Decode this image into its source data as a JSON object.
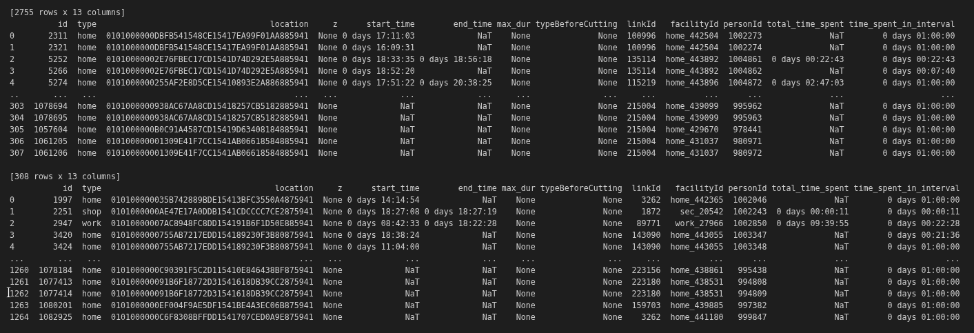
{
  "terminal": {
    "blocks": [
      {
        "kind": "text",
        "text": "[2755 rows x 13 columns]"
      },
      {
        "kind": "table",
        "columns": [
          {
            "header": "id",
            "kind": "number"
          },
          {
            "header": "type",
            "kind": "text"
          },
          {
            "header": "location",
            "kind": "text"
          },
          {
            "header": "z",
            "kind": "text"
          },
          {
            "header": "start_time",
            "kind": "duration"
          },
          {
            "header": "end_time",
            "kind": "duration"
          },
          {
            "header": "max_dur",
            "kind": "text"
          },
          {
            "header": "typeBeforeCutting",
            "kind": "text"
          },
          {
            "header": "linkId",
            "kind": "number"
          },
          {
            "header": "facilityId",
            "kind": "text"
          },
          {
            "header": "personId",
            "kind": "number"
          },
          {
            "header": "total_time_spent",
            "kind": "duration"
          },
          {
            "header": "time_spent_in_interval",
            "kind": "duration"
          }
        ],
        "rows": [
          {
            "index": "0",
            "cells": [
              "2311",
              "home",
              "0101000000DBFB541548CE15417EA99F01AA885941",
              "None",
              "0 days 17:11:03",
              "NaT",
              "None",
              "None",
              "100996",
              "home_442504",
              "1002273",
              "NaT",
              "0 days 01:00:00"
            ]
          },
          {
            "index": "1",
            "cells": [
              "2321",
              "home",
              "0101000000DBFB541548CE15417EA99F01AA885941",
              "None",
              "0 days 16:09:31",
              "NaT",
              "None",
              "None",
              "100996",
              "home_442504",
              "1002274",
              "NaT",
              "0 days 01:00:00"
            ]
          },
          {
            "index": "2",
            "cells": [
              "5252",
              "home",
              "01010000002E76FBEC17CD1541D74D292E5A885941",
              "None",
              "0 days 18:33:35",
              "0 days 18:56:18",
              "None",
              "None",
              "135114",
              "home_443892",
              "1004861",
              "0 days 00:22:43",
              "0 days 00:22:43"
            ]
          },
          {
            "index": "3",
            "cells": [
              "5266",
              "home",
              "01010000002E76FBEC17CD1541D74D292E5A885941",
              "None",
              "0 days 18:52:20",
              "NaT",
              "None",
              "None",
              "135114",
              "home_443892",
              "1004862",
              "NaT",
              "0 days 00:07:40"
            ]
          },
          {
            "index": "4",
            "cells": [
              "5274",
              "home",
              "0101000000255AF2E8D5CE15410893E2A886885941",
              "None",
              "0 days 17:51:22",
              "0 days 20:38:25",
              "None",
              "None",
              "115219",
              "home_443896",
              "1004872",
              "0 days 02:47:03",
              "0 days 01:00:00"
            ]
          },
          {
            "index": "..",
            "cells": [
              "...",
              "...",
              "...",
              "...",
              "...",
              "...",
              "...",
              "...",
              "...",
              "...",
              "...",
              "...",
              "..."
            ]
          },
          {
            "index": "303",
            "cells": [
              "1078694",
              "home",
              "0101000000938AC67AA8CD15418257CB5182885941",
              "None",
              "NaT",
              "NaT",
              "None",
              "None",
              "215004",
              "home_439099",
              "995962",
              "NaT",
              "0 days 01:00:00"
            ]
          },
          {
            "index": "304",
            "cells": [
              "1078695",
              "home",
              "0101000000938AC67AA8CD15418257CB5182885941",
              "None",
              "NaT",
              "NaT",
              "None",
              "None",
              "215004",
              "home_439099",
              "995963",
              "NaT",
              "0 days 01:00:00"
            ]
          },
          {
            "index": "305",
            "cells": [
              "1057604",
              "home",
              "0101000000B0C91A4587CD15419D63408184885941",
              "None",
              "NaT",
              "NaT",
              "None",
              "None",
              "215004",
              "home_429670",
              "978441",
              "NaT",
              "0 days 01:00:00"
            ]
          },
          {
            "index": "306",
            "cells": [
              "1061205",
              "home",
              "010100000001309E41F7CC1541AB06618584885941",
              "None",
              "NaT",
              "NaT",
              "None",
              "None",
              "215004",
              "home_431037",
              "980971",
              "NaT",
              "0 days 01:00:00"
            ]
          },
          {
            "index": "307",
            "cells": [
              "1061206",
              "home",
              "010100000001309E41F7CC1541AB06618584885941",
              "None",
              "NaT",
              "NaT",
              "None",
              "None",
              "215004",
              "home_431037",
              "980972",
              "NaT",
              "0 days 01:00:00"
            ]
          }
        ]
      },
      {
        "kind": "blank"
      },
      {
        "kind": "text",
        "text": "[308 rows x 13 columns]"
      },
      {
        "kind": "table",
        "columns": [
          {
            "header": "id",
            "kind": "number"
          },
          {
            "header": "type",
            "kind": "text"
          },
          {
            "header": "location",
            "kind": "text"
          },
          {
            "header": "z",
            "kind": "text"
          },
          {
            "header": "start_time",
            "kind": "duration"
          },
          {
            "header": "end_time",
            "kind": "duration"
          },
          {
            "header": "max_dur",
            "kind": "text"
          },
          {
            "header": "typeBeforeCutting",
            "kind": "text"
          },
          {
            "header": "linkId",
            "kind": "number"
          },
          {
            "header": "facilityId",
            "kind": "text"
          },
          {
            "header": "personId",
            "kind": "number"
          },
          {
            "header": "total_time_spent",
            "kind": "duration"
          },
          {
            "header": "time_spent_in_interval",
            "kind": "duration"
          }
        ],
        "rows": [
          {
            "index": "0",
            "cells": [
              "1997",
              "home",
              "010100000035B742889BDE15413BFC3550A4875941",
              "None",
              "0 days 14:14:54",
              "NaT",
              "None",
              "None",
              "3262",
              "home_442365",
              "1002046",
              "NaT",
              "0 days 01:00:00"
            ]
          },
          {
            "index": "1",
            "cells": [
              "2251",
              "shop",
              "0101000000AE47E17A0DDB1541CDCCCC7CE2875941",
              "None",
              "0 days 18:27:08",
              "0 days 18:27:19",
              "None",
              "None",
              "1872",
              "sec_20542",
              "1002243",
              "0 days 00:00:11",
              "0 days 00:00:11"
            ]
          },
          {
            "index": "2",
            "cells": [
              "2947",
              "work",
              "01010000007AC8948FC8DD154191B6F1D50E885941",
              "None",
              "0 days 08:42:33",
              "0 days 18:22:28",
              "None",
              "None",
              "89771",
              "work_27966",
              "1002850",
              "0 days 09:39:55",
              "0 days 00:22:28"
            ]
          },
          {
            "index": "3",
            "cells": [
              "3420",
              "home",
              "0101000000755AB7217EDD154189230F3B80875941",
              "None",
              "0 days 18:38:24",
              "NaT",
              "None",
              "None",
              "143090",
              "home_443055",
              "1003347",
              "NaT",
              "0 days 00:21:36"
            ]
          },
          {
            "index": "4",
            "cells": [
              "3424",
              "home",
              "0101000000755AB7217EDD154189230F3B80875941",
              "None",
              "0 days 11:04:00",
              "NaT",
              "None",
              "None",
              "143090",
              "home_443055",
              "1003348",
              "NaT",
              "0 days 01:00:00"
            ]
          },
          {
            "index": "...",
            "cells": [
              "...",
              "...",
              "...",
              "...",
              "...",
              "...",
              "...",
              "...",
              "...",
              "...",
              "...",
              "...",
              "..."
            ]
          },
          {
            "index": "1260",
            "cells": [
              "1078184",
              "home",
              "0101000000C90391F5C2D115410E846438BF875941",
              "None",
              "NaT",
              "NaT",
              "None",
              "None",
              "223156",
              "home_438861",
              "995438",
              "NaT",
              "0 days 01:00:00"
            ]
          },
          {
            "index": "1261",
            "cells": [
              "1077413",
              "home",
              "010100000091B6F18772D31541618DB39CC2875941",
              "None",
              "NaT",
              "NaT",
              "None",
              "None",
              "223180",
              "home_438531",
              "994808",
              "NaT",
              "0 days 01:00:00"
            ]
          },
          {
            "index": "1262",
            "cells": [
              "1077414",
              "home",
              "010100000091B6F18772D31541618DB39CC2875941",
              "None",
              "NaT",
              "NaT",
              "None",
              "None",
              "223180",
              "home_438531",
              "994809",
              "NaT",
              "0 days 01:00:00"
            ]
          },
          {
            "index": "1263",
            "cells": [
              "1080201",
              "home",
              "0101000000EF004F9AE5DF1541BE4A3EC06B875941",
              "None",
              "NaT",
              "NaT",
              "None",
              "None",
              "159703",
              "home_439885",
              "997382",
              "NaT",
              "0 days 01:00:00"
            ]
          },
          {
            "index": "1264",
            "cells": [
              "1082925",
              "home",
              "0101000000C6F8308BFFDD1541707CED0A9E875941",
              "None",
              "NaT",
              "NaT",
              "None",
              "None",
              "3262",
              "home_441180",
              "999847",
              "NaT",
              "0 days 01:00:00"
            ]
          }
        ]
      }
    ]
  }
}
